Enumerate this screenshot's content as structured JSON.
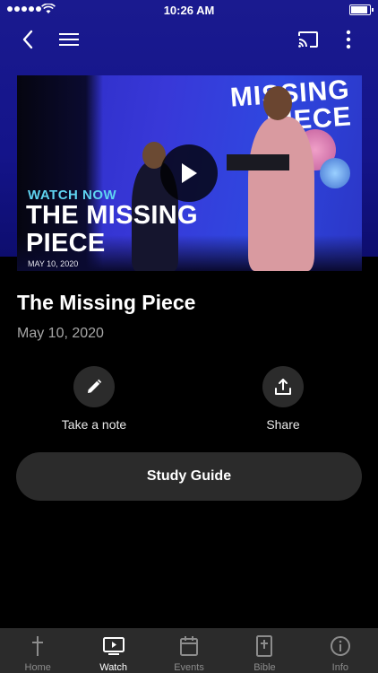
{
  "status_bar": {
    "time": "10:26 AM"
  },
  "nav": {
    "back_icon": "chevron-left-icon",
    "menu_icon": "hamburger-icon",
    "cast_icon": "cast-icon",
    "more_icon": "more-vertical-icon"
  },
  "video": {
    "watch_now": "WATCH NOW",
    "title_line1": "THE MISSING",
    "title_line2": "PIECE",
    "date": "MAY 10, 2020",
    "backdrop_line1": "MISSING",
    "backdrop_line2": "PIECE",
    "play_icon": "play-icon"
  },
  "sermon": {
    "title": "The Missing Piece",
    "date": "May 10, 2020"
  },
  "actions": {
    "note_label": "Take a note",
    "share_label": "Share"
  },
  "study_guide_label": "Study Guide",
  "tabs": [
    {
      "label": "Home",
      "icon": "cross-icon",
      "active": false
    },
    {
      "label": "Watch",
      "icon": "tv-play-icon",
      "active": true
    },
    {
      "label": "Events",
      "icon": "calendar-icon",
      "active": false
    },
    {
      "label": "Bible",
      "icon": "bible-icon",
      "active": false
    },
    {
      "label": "Info",
      "icon": "info-icon",
      "active": false
    }
  ],
  "colors": {
    "header_bg": "#1a1a8f",
    "accent_text": "#5fd3f0",
    "surface": "#2b2b2b"
  }
}
